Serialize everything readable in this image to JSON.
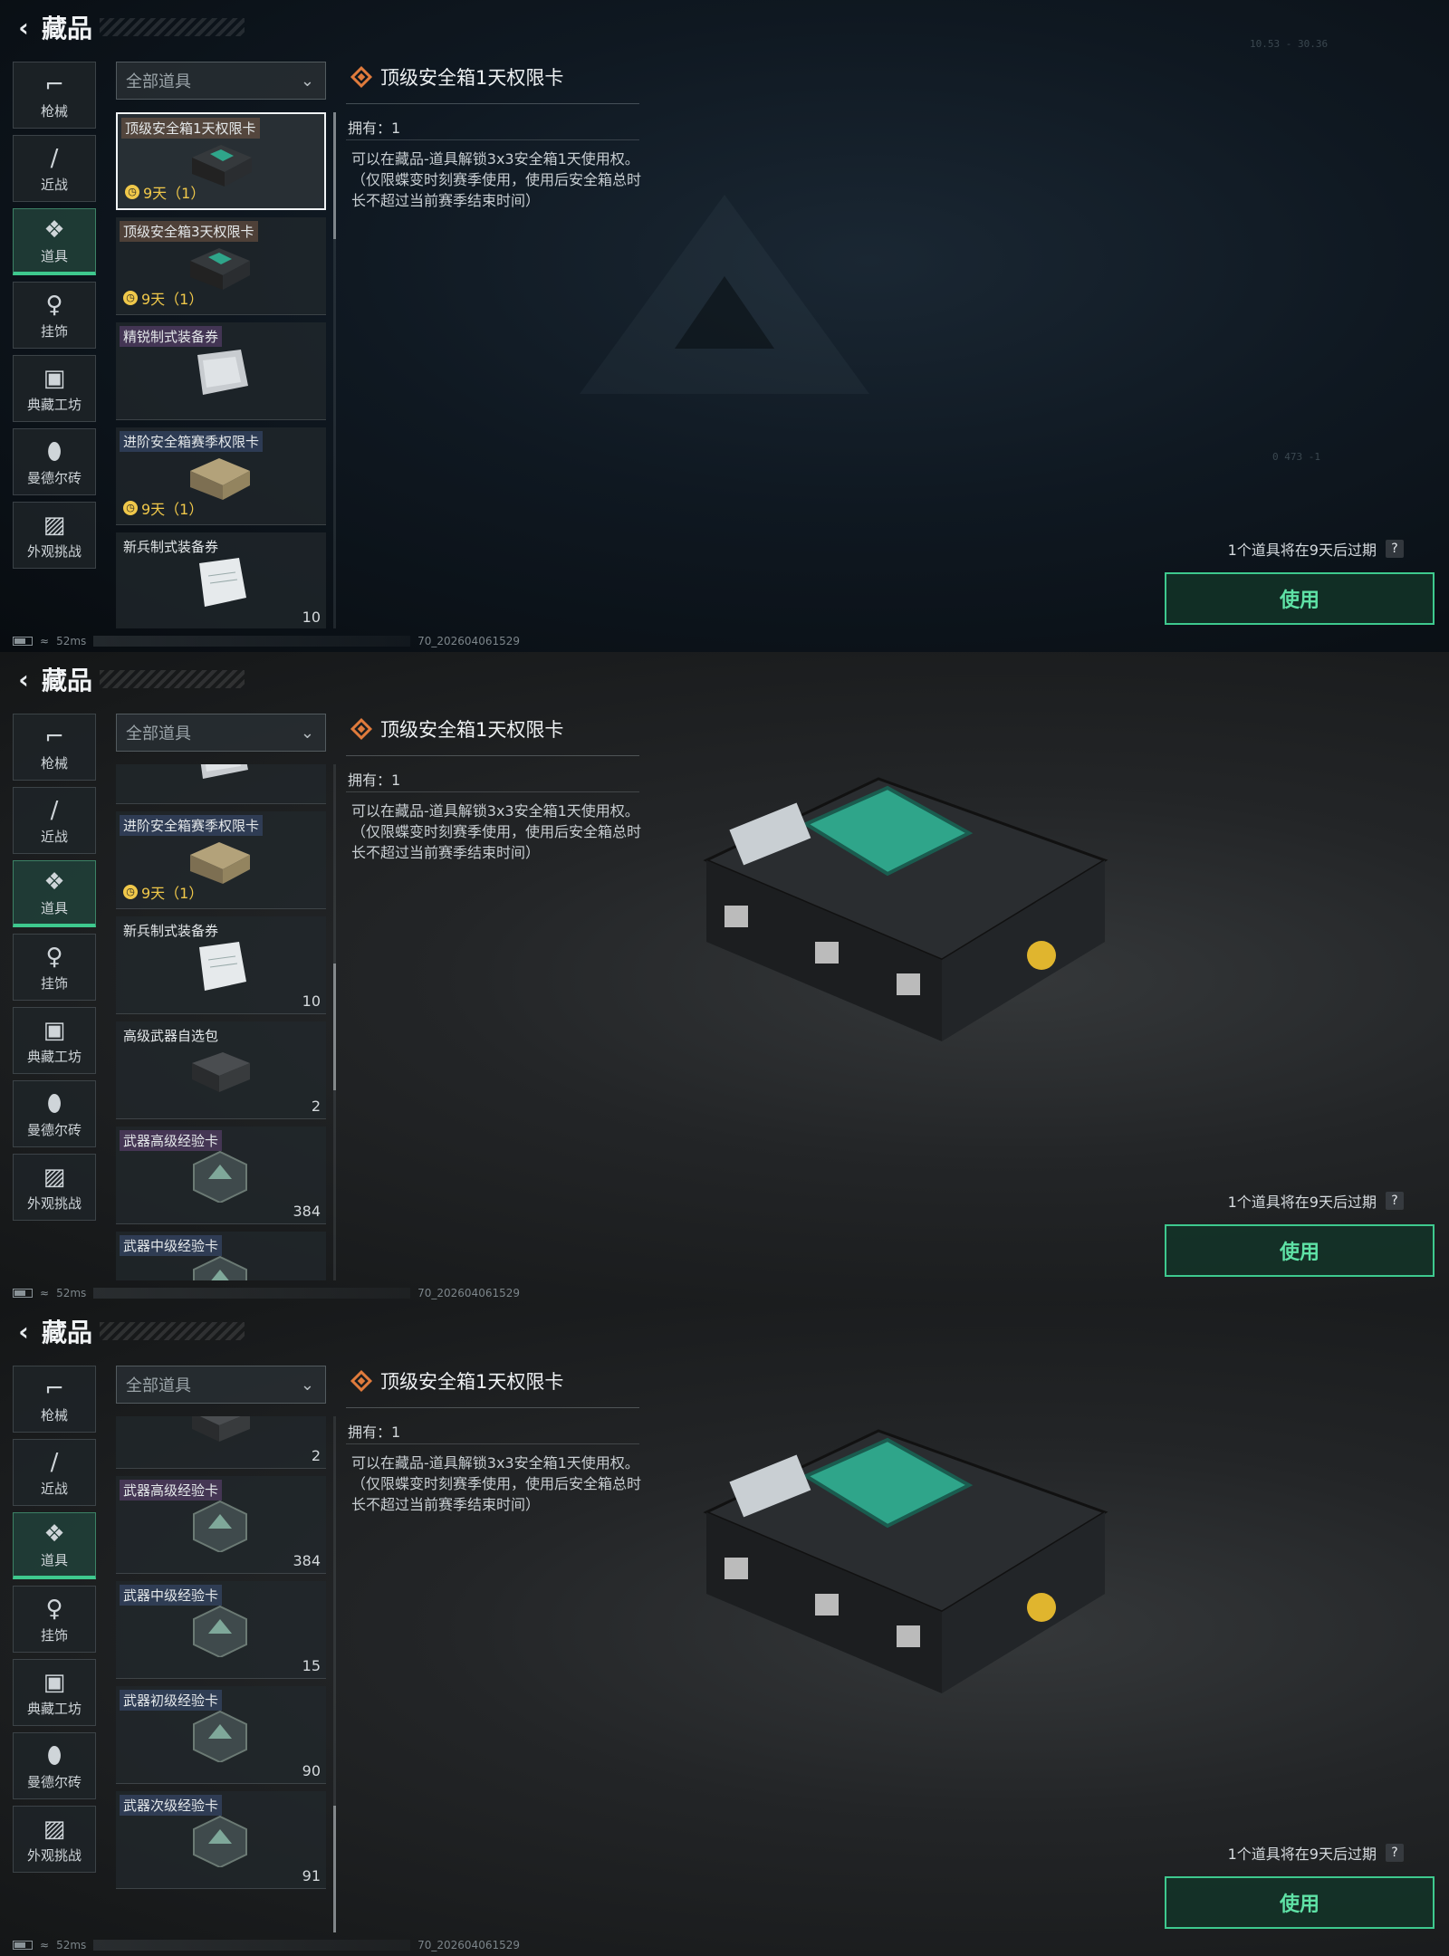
{
  "header": {
    "title": "藏品"
  },
  "sidebar": {
    "items": [
      {
        "label": "枪械",
        "icon": "gun-icon"
      },
      {
        "label": "近战",
        "icon": "knife-icon"
      },
      {
        "label": "道具",
        "icon": "cubes-icon",
        "active": true
      },
      {
        "label": "挂饰",
        "icon": "charm-icon"
      },
      {
        "label": "典藏工坊",
        "icon": "workshop-icon"
      },
      {
        "label": "曼德尔砖",
        "icon": "brick-icon"
      },
      {
        "label": "外观挑战",
        "icon": "challenge-icon"
      }
    ]
  },
  "filter": {
    "value": "全部道具"
  },
  "detail": {
    "title": "顶级安全箱1天权限卡",
    "owned": "拥有：1",
    "description": "可以在藏品-道具解锁3x3安全箱1天使用权。（仅限蝶变时刻赛季使用，使用后安全箱总时长不超过当前赛季结束时间）"
  },
  "footer": {
    "expire_notice": "1个道具将在9天后过期",
    "help": "?",
    "use_button": "使用"
  },
  "status": {
    "ping": "52ms",
    "build": "70_202604061529"
  },
  "hud": {
    "coords_top": "10.53 - 30.36",
    "coords_mid": "0    473    -1"
  },
  "panels": [
    {
      "list": [
        {
          "name": "顶级安全箱1天权限卡",
          "tag": "tan",
          "expire": "9天（1）",
          "count": "",
          "thumb": "case",
          "selected": true
        },
        {
          "name": "顶级安全箱3天权限卡",
          "tag": "tan",
          "expire": "9天（1）",
          "count": "",
          "thumb": "case"
        },
        {
          "name": "精锐制式装备券",
          "tag": "purple",
          "expire": "",
          "count": "",
          "thumb": "ticket"
        },
        {
          "name": "进阶安全箱赛季权限卡",
          "tag": "blue",
          "expire": "9天（1）",
          "count": "",
          "thumb": "tancase"
        },
        {
          "name": "新兵制式装备券",
          "tag": "plain",
          "expire": "",
          "count": "10",
          "thumb": "paper"
        }
      ]
    },
    {
      "list": [
        {
          "name": "",
          "tag": "plain",
          "expire": "",
          "count": "",
          "thumb": "ticket"
        },
        {
          "name": "进阶安全箱赛季权限卡",
          "tag": "blue",
          "expire": "9天（1）",
          "count": "",
          "thumb": "tancase"
        },
        {
          "name": "新兵制式装备券",
          "tag": "plain",
          "expire": "",
          "count": "10",
          "thumb": "paper"
        },
        {
          "name": "高级武器自选包",
          "tag": "plain",
          "expire": "",
          "count": "2",
          "thumb": "box"
        },
        {
          "name": "武器高级经验卡",
          "tag": "purple",
          "expire": "",
          "count": "384",
          "thumb": "hex"
        },
        {
          "name": "武器中级经验卡",
          "tag": "blue",
          "expire": "",
          "count": "",
          "thumb": "hex"
        }
      ]
    },
    {
      "list": [
        {
          "name": "",
          "tag": "plain",
          "expire": "",
          "count": "2",
          "thumb": "box"
        },
        {
          "name": "武器高级经验卡",
          "tag": "purple",
          "expire": "",
          "count": "384",
          "thumb": "hex"
        },
        {
          "name": "武器中级经验卡",
          "tag": "blue",
          "expire": "",
          "count": "15",
          "thumb": "hex"
        },
        {
          "name": "武器初级经验卡",
          "tag": "blue",
          "expire": "",
          "count": "90",
          "thumb": "hex"
        },
        {
          "name": "武器次级经验卡",
          "tag": "blue",
          "expire": "",
          "count": "91",
          "thumb": "hex"
        }
      ]
    }
  ],
  "colors": {
    "accent": "#3ec98e",
    "expire": "#f0c84a",
    "diamond": "#e07b3c"
  }
}
